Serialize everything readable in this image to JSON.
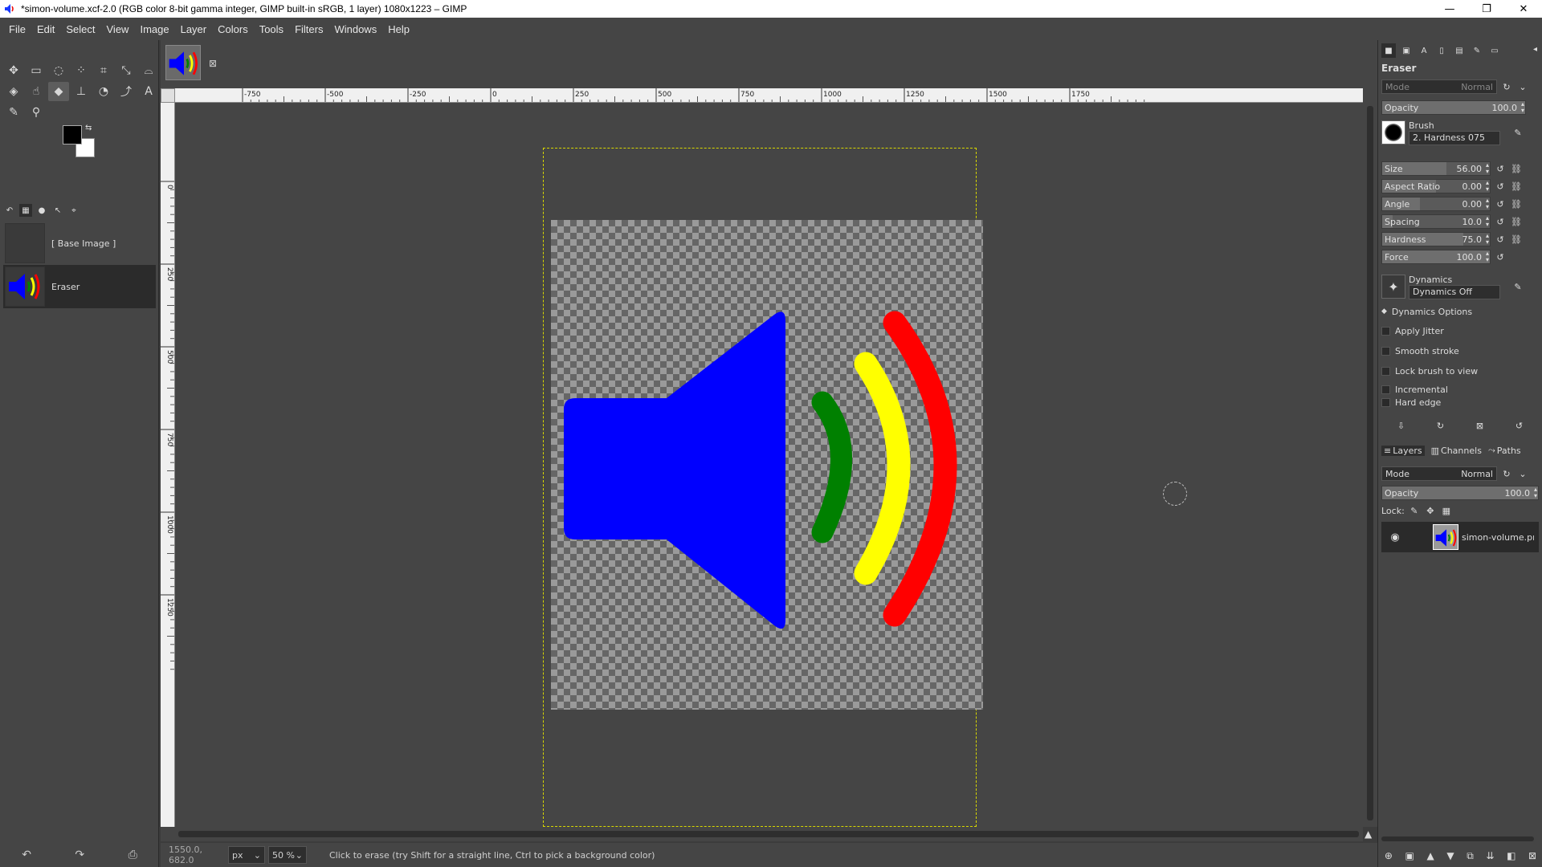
{
  "window": {
    "title": "*simon-volume.xcf-2.0 (RGB color 8-bit gamma integer, GIMP built-in sRGB, 1 layer) 1080x1223 – GIMP",
    "minimize": "—",
    "maximize": "❐",
    "close": "✕"
  },
  "menu": [
    "File",
    "Edit",
    "Select",
    "View",
    "Image",
    "Layer",
    "Colors",
    "Tools",
    "Filters",
    "Windows",
    "Help"
  ],
  "history": {
    "items": [
      {
        "label": "[ Base Image ]"
      },
      {
        "label": "Eraser"
      }
    ]
  },
  "imgtab": {
    "close": "⊠"
  },
  "ruler": {
    "top_ticks": [
      "-750",
      "-500",
      "-250",
      "0",
      "250",
      "500",
      "750",
      "1000",
      "1250",
      "1500",
      "1750"
    ],
    "left_ticks": [
      "0",
      "250",
      "500",
      "750",
      "1000",
      "1250"
    ]
  },
  "status": {
    "coords": "1550.0, 682.0",
    "unit": "px",
    "zoom": "50 %",
    "message": "Click to erase (try Shift for a straight line, Ctrl to pick a background color)"
  },
  "tool_options": {
    "title": "Eraser",
    "mode_label": "Mode",
    "mode_value": "Normal",
    "opacity_label": "Opacity",
    "opacity_value": "100.0",
    "opacity_fraction": 1.0,
    "brush_label": "Brush",
    "brush_value": "2. Hardness 075",
    "sliders": [
      {
        "label": "Size",
        "value": "56.00",
        "fraction": 0.6
      },
      {
        "label": "Aspect Ratio",
        "value": "0.00",
        "fraction": 0.5
      },
      {
        "label": "Angle",
        "value": "0.00",
        "fraction": 0.35
      },
      {
        "label": "Spacing",
        "value": "10.0",
        "fraction": 0.1
      },
      {
        "label": "Hardness",
        "value": "75.0",
        "fraction": 0.75
      },
      {
        "label": "Force",
        "value": "100.0",
        "fraction": 1.0
      }
    ],
    "dynamics_label": "Dynamics",
    "dynamics_value": "Dynamics Off",
    "dynamics_options": "Dynamics Options",
    "checks": [
      "Apply Jitter",
      "Smooth stroke",
      "Lock brush to view",
      "Incremental",
      "Hard edge"
    ]
  },
  "layers_panel": {
    "tabs": [
      "Layers",
      "Channels",
      "Paths"
    ],
    "mode_label": "Mode",
    "mode_value": "Normal",
    "opacity_label": "Opacity",
    "opacity_value": "100.0",
    "lock_label": "Lock:",
    "layer_name": "simon-volume.png"
  },
  "colors": {
    "speaker": "#0000ff",
    "wave_small": "#008000",
    "wave_mid": "#ffff00",
    "wave_large": "#ff0000",
    "guide": "#d8d800"
  }
}
